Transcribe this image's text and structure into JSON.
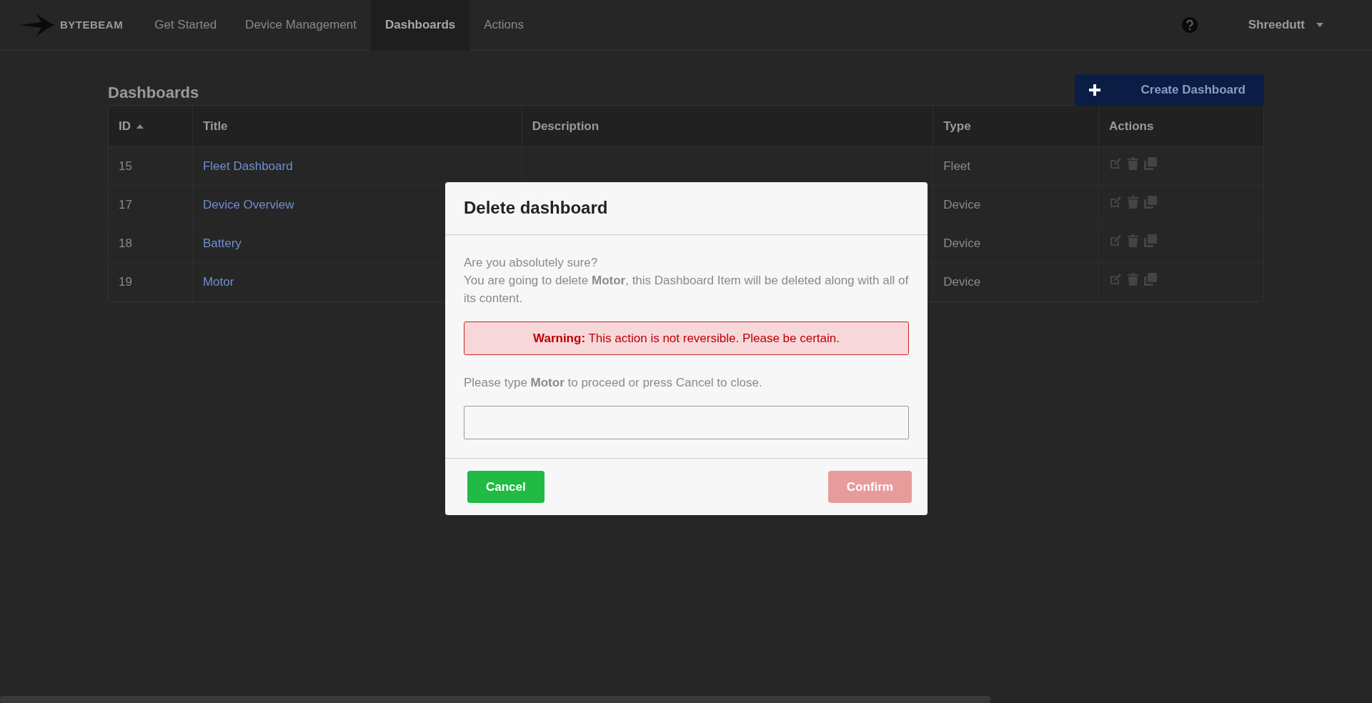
{
  "navbar": {
    "brand": "BYTEBEAM",
    "items": [
      {
        "label": "Get Started",
        "selected": false
      },
      {
        "label": "Device Management",
        "selected": false
      },
      {
        "label": "Dashboards",
        "selected": true
      },
      {
        "label": "Actions",
        "selected": false
      }
    ],
    "user": "Shreedutt"
  },
  "page": {
    "title": "Dashboards",
    "create_button": "Create Dashboard"
  },
  "table": {
    "columns": [
      {
        "label": "ID",
        "sorted": true
      },
      {
        "label": "Title",
        "sorted": false
      },
      {
        "label": "Description",
        "sorted": false
      },
      {
        "label": "Type",
        "sorted": false
      },
      {
        "label": "Actions",
        "sorted": false
      }
    ],
    "rows": [
      {
        "id": "15",
        "title": "Fleet Dashboard",
        "type": "Fleet"
      },
      {
        "id": "17",
        "title": "Device Overview",
        "type": "Device"
      },
      {
        "id": "18",
        "title": "Battery",
        "type": "Device"
      },
      {
        "id": "19",
        "title": "Motor",
        "type": "Device"
      }
    ]
  },
  "modal": {
    "title": "Delete dashboard",
    "question": "Are you absolutely sure?",
    "message": "You are going to delete **Motor**, this Dashboard Item will be deleted along with all of its content.",
    "warning": "**Warning:** This action is not reversible. Please be certain.",
    "prompt": "Please type **Motor** to proceed or press Cancel to close.",
    "cancel": "Cancel",
    "confirm": {
      "label": "Confirm",
      "disabled": true
    }
  }
}
